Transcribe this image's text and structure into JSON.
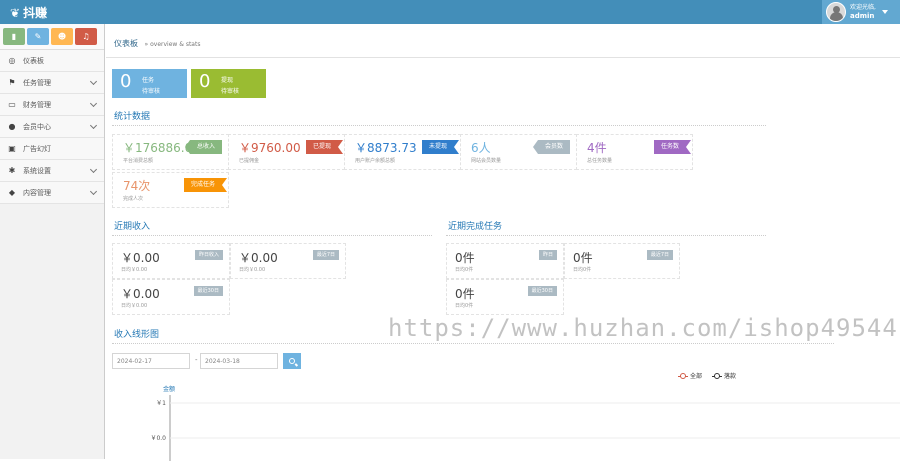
{
  "topbar": {
    "brand": "抖赚",
    "greeting": "欢迎光临,",
    "username": "admin",
    "bg": "#438eb9"
  },
  "shortcuts": [
    {
      "icon": "chart-icon",
      "glyph": "▮",
      "color": "#87b87f"
    },
    {
      "icon": "pencil-icon",
      "glyph": "✎",
      "color": "#6fb3e0"
    },
    {
      "icon": "users-icon",
      "glyph": "☻",
      "color": "#ffb752"
    },
    {
      "icon": "bell-icon",
      "glyph": "♫",
      "color": "#d15b47"
    }
  ],
  "sidebar": {
    "items": [
      {
        "label": "仪表板",
        "icon": "dashboard-icon",
        "glyph": "◎",
        "has_children": false
      },
      {
        "label": "任务管理",
        "icon": "flag-icon",
        "glyph": "⚑",
        "has_children": true
      },
      {
        "label": "财务管理",
        "icon": "inbox-icon",
        "glyph": "▭",
        "has_children": true
      },
      {
        "label": "会员中心",
        "icon": "user-icon",
        "glyph": "●",
        "has_children": true
      },
      {
        "label": "广告幻灯",
        "icon": "picture-icon",
        "glyph": "▣",
        "has_children": false
      },
      {
        "label": "系统设置",
        "icon": "gear-icon",
        "glyph": "✱",
        "has_children": true
      },
      {
        "label": "内容管理",
        "icon": "folder-icon",
        "glyph": "◆",
        "has_children": true
      }
    ]
  },
  "breadcrumb": {
    "title": "仪表板",
    "subtitle": "» overview & stats"
  },
  "pending": [
    {
      "count": "0",
      "line1": "任务",
      "line2": "待审核",
      "color": "#6fb3e0"
    },
    {
      "count": "0",
      "line1": "提现",
      "line2": "待审核",
      "color": "#9abc32"
    }
  ],
  "stats_title": "统计数据",
  "stats": [
    {
      "value": "￥176886.0",
      "desc": "平台消费总额",
      "tag": "总收入",
      "color": "#87b87f"
    },
    {
      "value": "￥9760.00",
      "desc": "已提佣金",
      "tag": "已提现",
      "color": "#d15b47"
    },
    {
      "value": "￥8873.73",
      "desc": "用户账户余额总额",
      "tag": "未提现",
      "color": "#307ecc"
    },
    {
      "value": "6人",
      "desc": "网站会员数量",
      "tag": "会员数",
      "color": "#6fb3e0",
      "tag_color": "#abbac3"
    },
    {
      "value": "4件",
      "desc": "总任务数量",
      "tag": "任务数",
      "color": "#a069c3"
    },
    {
      "value": "74次",
      "desc": "完成人次",
      "tag": "完成任务",
      "color": "#e8956b",
      "tag_color": "#f89406"
    }
  ],
  "income_title": "近期收入",
  "income": [
    {
      "value": "￥0.00",
      "desc": "日均￥0.00",
      "tag": "昨日收入"
    },
    {
      "value": "￥0.00",
      "desc": "日均￥0.00",
      "tag": "最近7日"
    },
    {
      "value": "￥0.00",
      "desc": "日均￥0.00",
      "tag": "最近30日"
    }
  ],
  "tasks_title": "近期完成任务",
  "tasks": [
    {
      "value": "0件",
      "desc": "日均0件",
      "tag": "昨日"
    },
    {
      "value": "0件",
      "desc": "日均0件",
      "tag": "最近7日"
    },
    {
      "value": "0件",
      "desc": "日均0件",
      "tag": "最近30日"
    }
  ],
  "chart_section_title": "收入线形图",
  "date_from": "2024-02-17",
  "date_to": "2024-03-18",
  "date_sep": "-",
  "chart_data": {
    "type": "line",
    "ylabel": "金额",
    "y_ticks": [
      "￥1",
      "￥0.0"
    ],
    "series": [
      {
        "name": "全部",
        "values": [],
        "color": "#d15b47"
      },
      {
        "name": "落款",
        "values": [],
        "color": "#333333"
      }
    ]
  },
  "watermark": "https://www.huzhan.com/ishop49544"
}
